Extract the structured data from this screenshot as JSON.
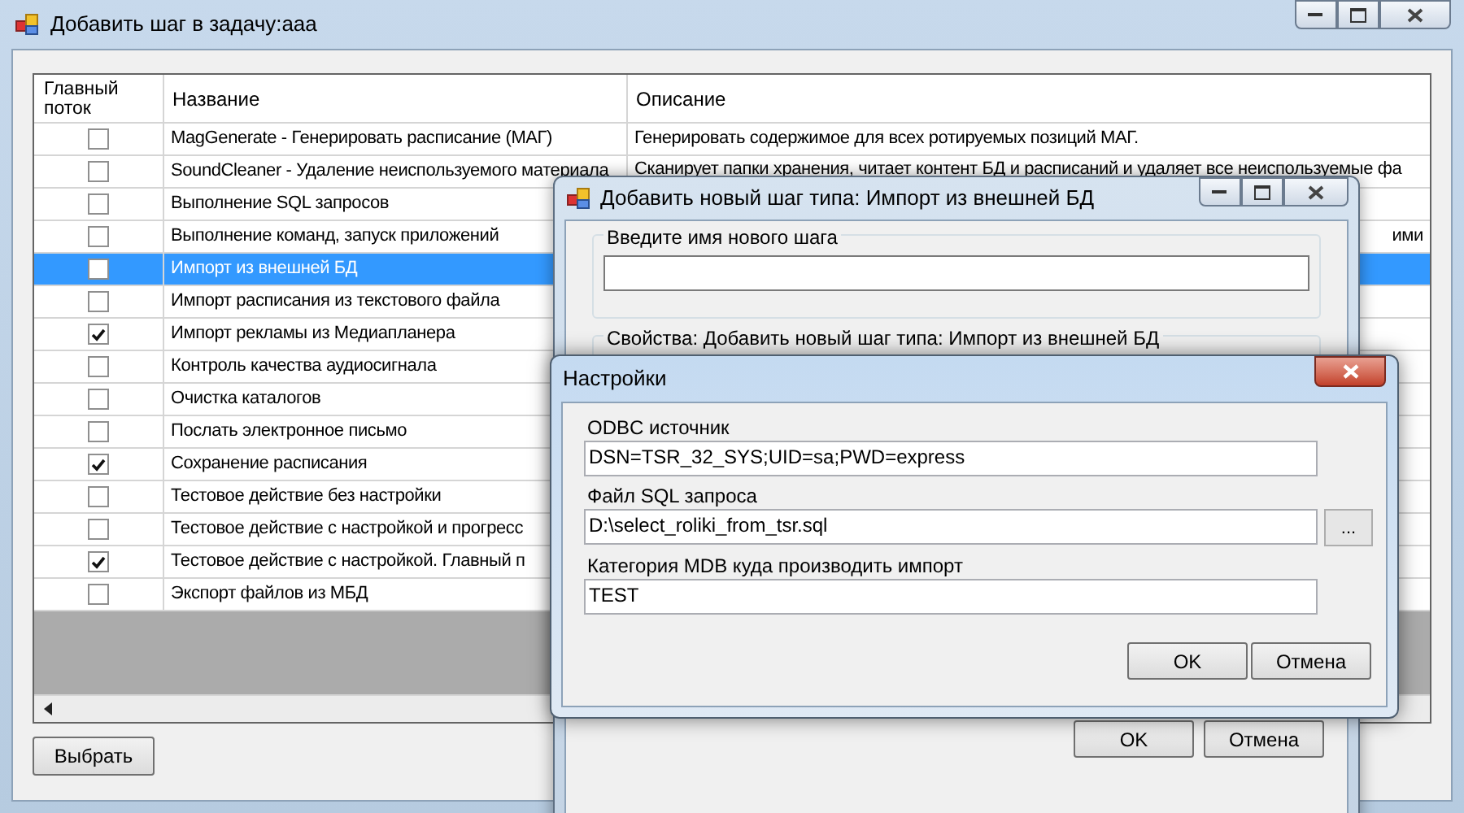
{
  "main_window": {
    "title": "Добавить шаг в задачу:aaa",
    "table": {
      "columns": [
        "Главный поток",
        "Название",
        "Описание"
      ],
      "rows": [
        {
          "main_thread": false,
          "selected": false,
          "name": "MagGenerate - Генерировать расписание (МАГ)",
          "description": "Генерировать содержимое для всех ротируемых позиций МАГ."
        },
        {
          "main_thread": false,
          "selected": false,
          "name": "SoundCleaner - Удаление неиспользуемого материала",
          "description": "Сканирует папки хранения, читает контент БД и расписаний и удаляет все неиспользуемые фа"
        },
        {
          "main_thread": false,
          "selected": false,
          "name": "Выполнение SQL запросов"
        },
        {
          "main_thread": false,
          "selected": false,
          "name": "Выполнение команд, запуск приложений",
          "description": "ими"
        },
        {
          "main_thread": false,
          "selected": true,
          "name": "Импорт из внешней БД"
        },
        {
          "main_thread": false,
          "selected": false,
          "name": "Импорт расписания из текстового файла"
        },
        {
          "main_thread": true,
          "selected": false,
          "name": "Импорт рекламы из Медиапланера"
        },
        {
          "main_thread": false,
          "selected": false,
          "name": "Контроль качества аудиосигнала"
        },
        {
          "main_thread": false,
          "selected": false,
          "name": "Очистка каталогов"
        },
        {
          "main_thread": false,
          "selected": false,
          "name": "Послать электронное письмо"
        },
        {
          "main_thread": true,
          "selected": false,
          "name": "Сохранение расписания"
        },
        {
          "main_thread": false,
          "selected": false,
          "name": "Тестовое действие без настройки"
        },
        {
          "main_thread": false,
          "selected": false,
          "name": "Тестовое действие с настройкой и прогресс"
        },
        {
          "main_thread": true,
          "selected": false,
          "name": "Тестовое действие с настройкой. Главный п"
        },
        {
          "main_thread": false,
          "selected": false,
          "name": "Экспорт файлов из МБД"
        }
      ]
    },
    "button": "Выбрать"
  },
  "step_window": {
    "title": "Добавить новый шаг типа: Импорт из внешней БД",
    "name_group": {
      "label": "Введите имя нового шага"
    },
    "properties_group": {
      "label": "Свойства: Добавить новый шаг типа: Импорт из внешней БД"
    },
    "buttons": [
      "OK",
      "Отмена"
    ]
  },
  "settings_dialog": {
    "title": "Настройки",
    "fields": [
      {
        "label": "ODBC источник",
        "value": "DSN=TSR_32_SYS;UID=sa;PWD=express"
      },
      {
        "label": "Файл SQL запроса",
        "value": "D:\\select_roliki_from_tsr.sql",
        "browse_button": "..."
      },
      {
        "label": "Категория MDB куда производить импорт",
        "value": "TEST"
      }
    ],
    "buttons": [
      "OK",
      "Отмена"
    ]
  }
}
